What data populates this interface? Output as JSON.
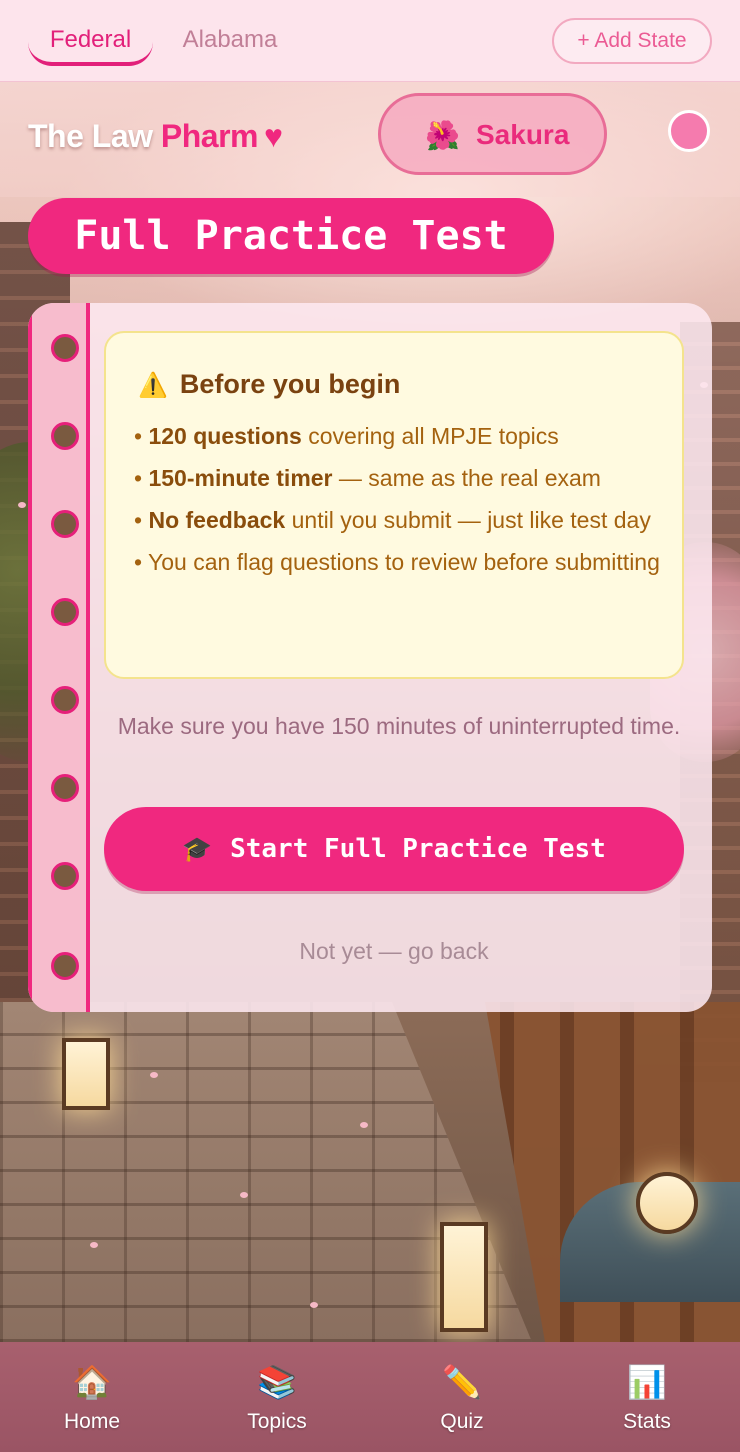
{
  "tabs": {
    "federal_label": "Federal",
    "alabama_label": "Alabama",
    "add_state_label": "+ Add State"
  },
  "header": {
    "brand_part1": "The Law",
    "brand_part2": "Pharm",
    "brand_heart": "♥",
    "theme_icon": "🌺",
    "theme_label": "Sakura"
  },
  "page_title": "Full Practice Test",
  "notice": {
    "icon": "⚠️",
    "title": "Before you begin",
    "items": [
      {
        "bold": "120 questions",
        "rest": " covering all MPJE topics"
      },
      {
        "bold": "150-minute timer",
        "rest": " — same as the real exam"
      },
      {
        "bold": "No feedback",
        "rest": " until you submit — just like test day"
      },
      {
        "bold": "",
        "rest": "You can flag questions to review before submitting"
      }
    ]
  },
  "note": "Make sure you have 150 minutes of uninterrupted time.",
  "start_button": {
    "icon": "🎓",
    "label": "Start Full Practice Test"
  },
  "back_link": "Not yet — go back",
  "bottom_nav": [
    {
      "icon": "🏠",
      "label": "Home"
    },
    {
      "icon": "📚",
      "label": "Topics"
    },
    {
      "icon": "✏️",
      "label": "Quiz"
    },
    {
      "icon": "📊",
      "label": "Stats"
    }
  ],
  "colors": {
    "accent": "#f0287f",
    "notice_bg": "#fffae0",
    "notice_text": "#a4620f"
  }
}
